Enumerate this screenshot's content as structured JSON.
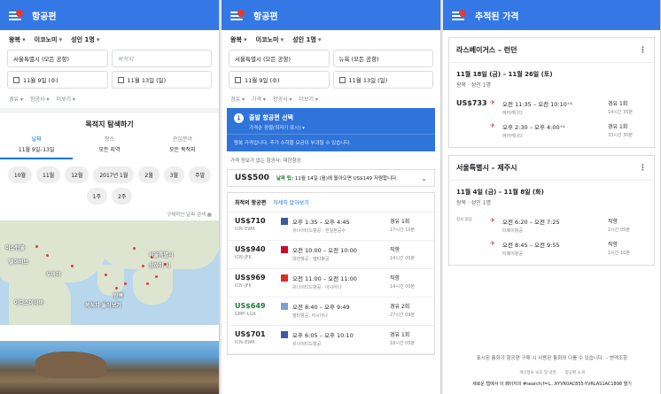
{
  "panel1": {
    "title": "항공편",
    "options": [
      "왕복",
      "이코노미",
      "성인 1명"
    ],
    "origin": "서울특별시 (모든 공항)",
    "destination_placeholder": "목적지",
    "depart_date": "11월 9일 (수)",
    "return_date": "11월 13일 (일)",
    "filters": [
      "경유",
      "항공사",
      "더보기"
    ],
    "explore_title": "목적지 탐색하기",
    "explore_tabs": [
      {
        "key": "날짜",
        "value": "11월 9일–13일",
        "active": true
      },
      {
        "key": "장소",
        "value": "모든 지역",
        "active": false
      },
      {
        "key": "관심분야",
        "value": "모든 목적지",
        "active": false
      }
    ],
    "date_chips": [
      "10월",
      "11월",
      "12월",
      "2017년 1월",
      "2월",
      "3월",
      "주말",
      "1주",
      "2주"
    ],
    "search_dates_label": "구체적인 날짜 검색",
    "map_labels": [
      "이스탄불",
      "텔아비브",
      "두바이",
      "서울특별시",
      "상하이 시",
      "방콕",
      "아디스아바바",
      "목적지 둘러보기"
    ]
  },
  "panel2": {
    "title": "항공편",
    "options": [
      "왕복",
      "이코노미",
      "성인 1명"
    ],
    "origin": "서울특별시 (모든 공항)",
    "destination": "뉴욕 (모든 공항)",
    "depart_date": "11월 9일 (수)",
    "return_date": "11월 13일 (일)",
    "filters": [
      "경유",
      "가격",
      "항공사",
      "더보기"
    ],
    "blue_card": {
      "title": "출발 항공편 선택",
      "subtitle": "가격순 정렬(최저가 표시) ▾",
      "note": "왕복 가격입니다. 추가 수하물 요금이 부과될 수 있습니다."
    },
    "price_info": "가격 정보가 없는 항공사: 대한항공",
    "tip": {
      "price": "US$500",
      "lead": "날짜 팁:",
      "text": "11월 14일 (월)에 돌아오면 US$149 저렴합니다."
    },
    "list_header": {
      "best": "최적의 항공편",
      "more": "자세히 알아보기"
    },
    "flights": [
      {
        "price": "US$710",
        "route": "ICN–EWR",
        "time": "오후 1:35 – 오후 4:45",
        "airline": "유나이티드항공 · 전일본공수",
        "stops": "경유 1회",
        "duration": "17시간 10분",
        "logo": "#3a5ba0",
        "green": false
      },
      {
        "price": "US$940",
        "route": "ICN–JFK",
        "time": "오전 10:00 – 오전 10:00",
        "airline": "대한항공 · 델타항공",
        "stops": "직항",
        "duration": "14시간 00분",
        "logo": "#c8102e",
        "green": false
      },
      {
        "price": "US$969",
        "route": "ICN–JFK",
        "time": "오전 11:00 – 오전 11:00",
        "airline": "유나이티드항공 · 아시아나",
        "stops": "직항",
        "duration": "14시간 00분",
        "logo": "#d93025",
        "green": false
      },
      {
        "price": "US$649",
        "route": "GMP–LGA",
        "time": "오전 8:40 – 오후 9:49",
        "airline": "델타항공, 아시아나",
        "stops": "경유 2회",
        "duration": "27시간 09분",
        "logo": "#7b9fd4",
        "green": true
      },
      {
        "price": "US$701",
        "route": "ICN–EWR",
        "time": "오후 6:05 – 오후 10:10",
        "airline": "유나이티드항공",
        "stops": "경유 1회",
        "duration": "18시간 05분",
        "logo": "#3a5ba0",
        "green": false
      }
    ]
  },
  "panel3": {
    "title": "추적된 가격",
    "trips": [
      {
        "route": "라스베이거스 – 런던",
        "dates": "11월 18일 (금) – 11월 26일 (토)",
        "pax": "왕복 · 성인 1명",
        "rows": [
          {
            "price": "US$733",
            "time": "오전 11:35 – 오전 10:10⁺¹",
            "airline": "에어캐나다",
            "stops": "경유 1회",
            "duration": "14시간 35분"
          },
          {
            "price": "",
            "time": "오후 2:30 – 오후 4:00⁺¹",
            "airline": "에어캐나다",
            "stops": "경유 1회",
            "duration": "33시간 30분"
          }
        ]
      },
      {
        "route": "서울특별시 – 제주시",
        "dates": "11월 4일 (금) – 11월 8일 (화)",
        "pax": "왕복 · 성인 1명",
        "rows": [
          {
            "price": "",
            "small": "정보 없음",
            "time": "오전 6:20 – 오전 7:25",
            "airline": "티웨이항공",
            "stops": "직항",
            "duration": "1시간 05분"
          },
          {
            "price": "",
            "time": "오전 8:45 – 오전 9:55",
            "airline": "티웨이항공",
            "stops": "직항",
            "duration": "1시간 10분"
          }
        ]
      }
    ],
    "disclaimer": "표시된 통화가 항공편 구매 시 사용된 통화와 다를 수 있습니다. – 변액조항",
    "footer_links": [
      "개인정보 보호 및 약관",
      "항공편 소개"
    ],
    "url": "새로운 탭에서 이 페이지의 #search;f=L...RYVR0AC855-YVRLAS1AC1898 열기"
  }
}
